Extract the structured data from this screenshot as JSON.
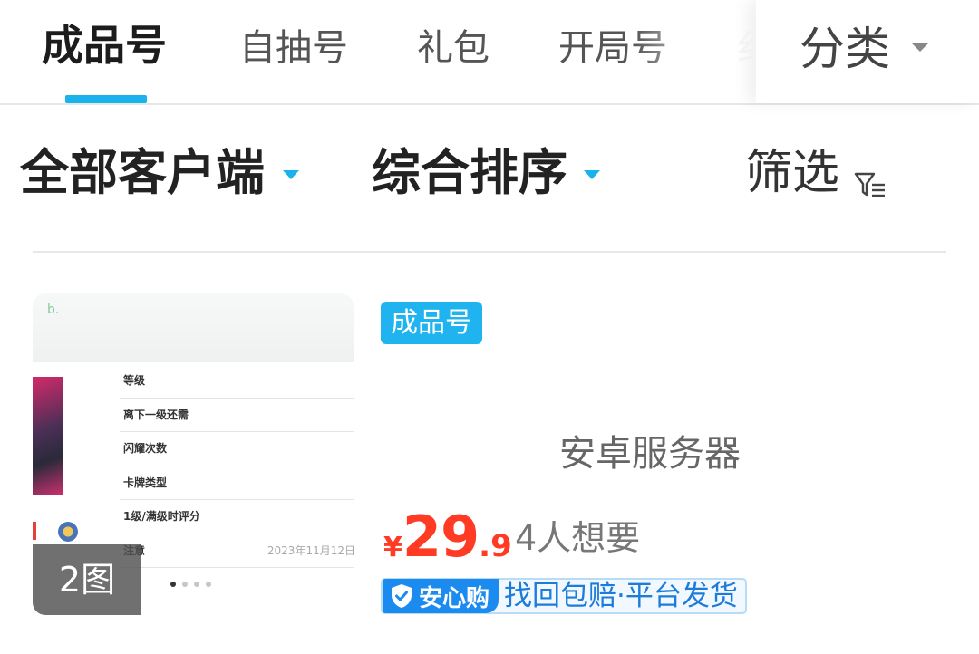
{
  "tabs": [
    {
      "label": "成品号",
      "active": true
    },
    {
      "label": "自抽号",
      "active": false
    },
    {
      "label": "礼包",
      "active": false
    },
    {
      "label": "开局号",
      "active": false
    },
    {
      "label": "纟",
      "active": false
    }
  ],
  "category": {
    "label": "分类",
    "icon": "chevron-down-icon"
  },
  "filters": {
    "client": "全部客户端",
    "sort": "综合排序",
    "filter": "筛选",
    "filter_icon": "filter-icon"
  },
  "colors": {
    "accent": "#19b2ea",
    "price": "#ff3b24",
    "assure": "#1c8bf0"
  },
  "listing": {
    "thumbnail": {
      "mark": "b.",
      "rows": [
        "等级",
        "离下一级还需",
        "闪耀次数",
        "卡牌类型",
        "1级/满级时评分",
        "注意"
      ],
      "date": "2023年11月12日",
      "image_count": "2图",
      "carousel": {
        "total": 4,
        "current": 1
      }
    },
    "tag": "成品号",
    "server": "安卓服务器",
    "price": {
      "symbol": "¥",
      "integer": "29",
      "decimal": ".9"
    },
    "wants": "4人想要",
    "assurance": {
      "badge": "安心购",
      "text": "找回包赔·平台发货",
      "icon": "shield-check-icon"
    }
  }
}
